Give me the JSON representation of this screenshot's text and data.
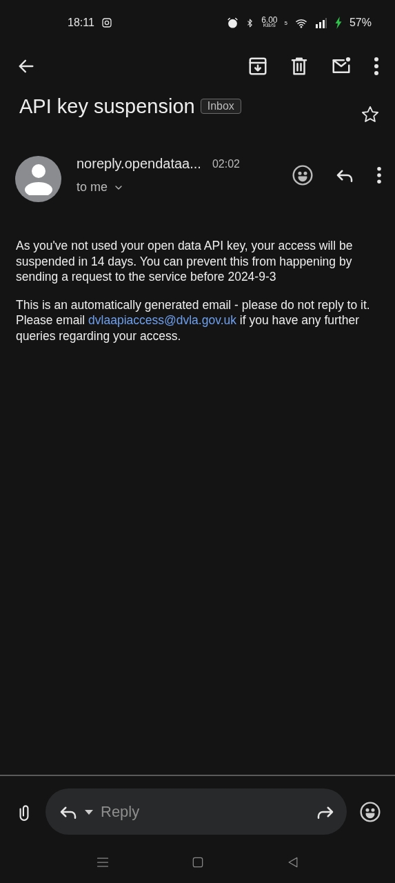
{
  "status_bar": {
    "time": "18:11",
    "net_speed": "6.00",
    "net_unit": "KB/S",
    "wifi_band": "5",
    "battery": "57%"
  },
  "subject": {
    "title": "API key suspension",
    "label": "Inbox",
    "starred": false
  },
  "message": {
    "sender": "noreply.opendataa...",
    "time": "02:02",
    "recipient": "to me"
  },
  "body": [
    {
      "parts": [
        {
          "kind": "text",
          "text": "As you've not used your open data API key, your access will be suspended in 14 days. You can prevent this from happening by sending a request to the service before 2024-9-3"
        }
      ]
    },
    {
      "parts": [
        {
          "kind": "text",
          "text": "This is an automatically generated email - please do not reply to it. Please email "
        },
        {
          "kind": "link",
          "text": "dvlaapiaccess@dvla.gov.uk"
        },
        {
          "kind": "text",
          "text": " if you have any further queries regarding your access."
        }
      ]
    }
  ],
  "reply_bar": {
    "placeholder": "Reply"
  }
}
